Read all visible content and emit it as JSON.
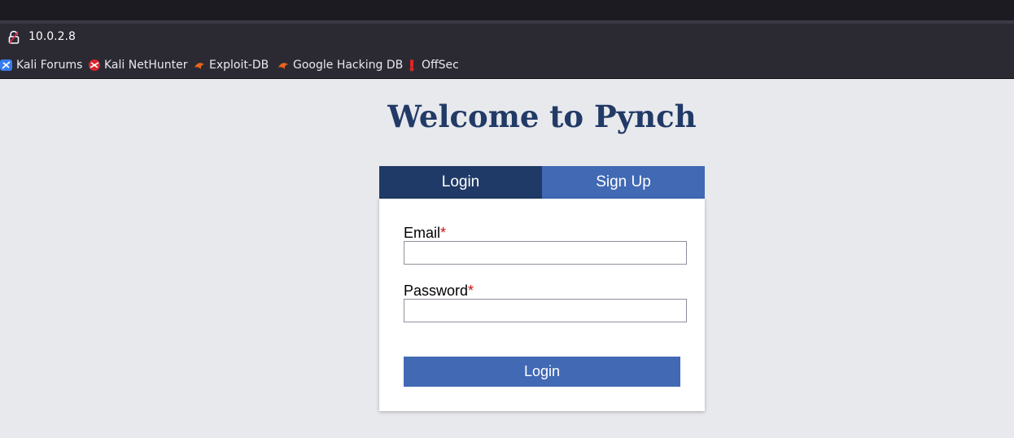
{
  "browser": {
    "url": "10.0.2.8",
    "bookmarks": [
      {
        "label": "Kali Forums",
        "icon": "kali-forums-icon"
      },
      {
        "label": "Kali NetHunter",
        "icon": "kali-nethunter-icon"
      },
      {
        "label": "Exploit-DB",
        "icon": "exploit-db-icon"
      },
      {
        "label": "Google Hacking DB",
        "icon": "google-hacking-db-icon"
      },
      {
        "label": "OffSec",
        "icon": "offsec-icon"
      }
    ]
  },
  "page": {
    "title": "Welcome to Pynch",
    "tabs": {
      "login": "Login",
      "signup": "Sign Up"
    },
    "form": {
      "email_label": "Email",
      "email_value": "",
      "password_label": "Password",
      "password_value": "",
      "required_marker": "*",
      "submit_label": "Login"
    }
  },
  "colors": {
    "page_background": "#e8e9ed",
    "title": "#213a66",
    "active_tab": "#1f3a66",
    "inactive_tab": "#4169b4",
    "button": "#4169b4",
    "required": "#cc1111"
  }
}
